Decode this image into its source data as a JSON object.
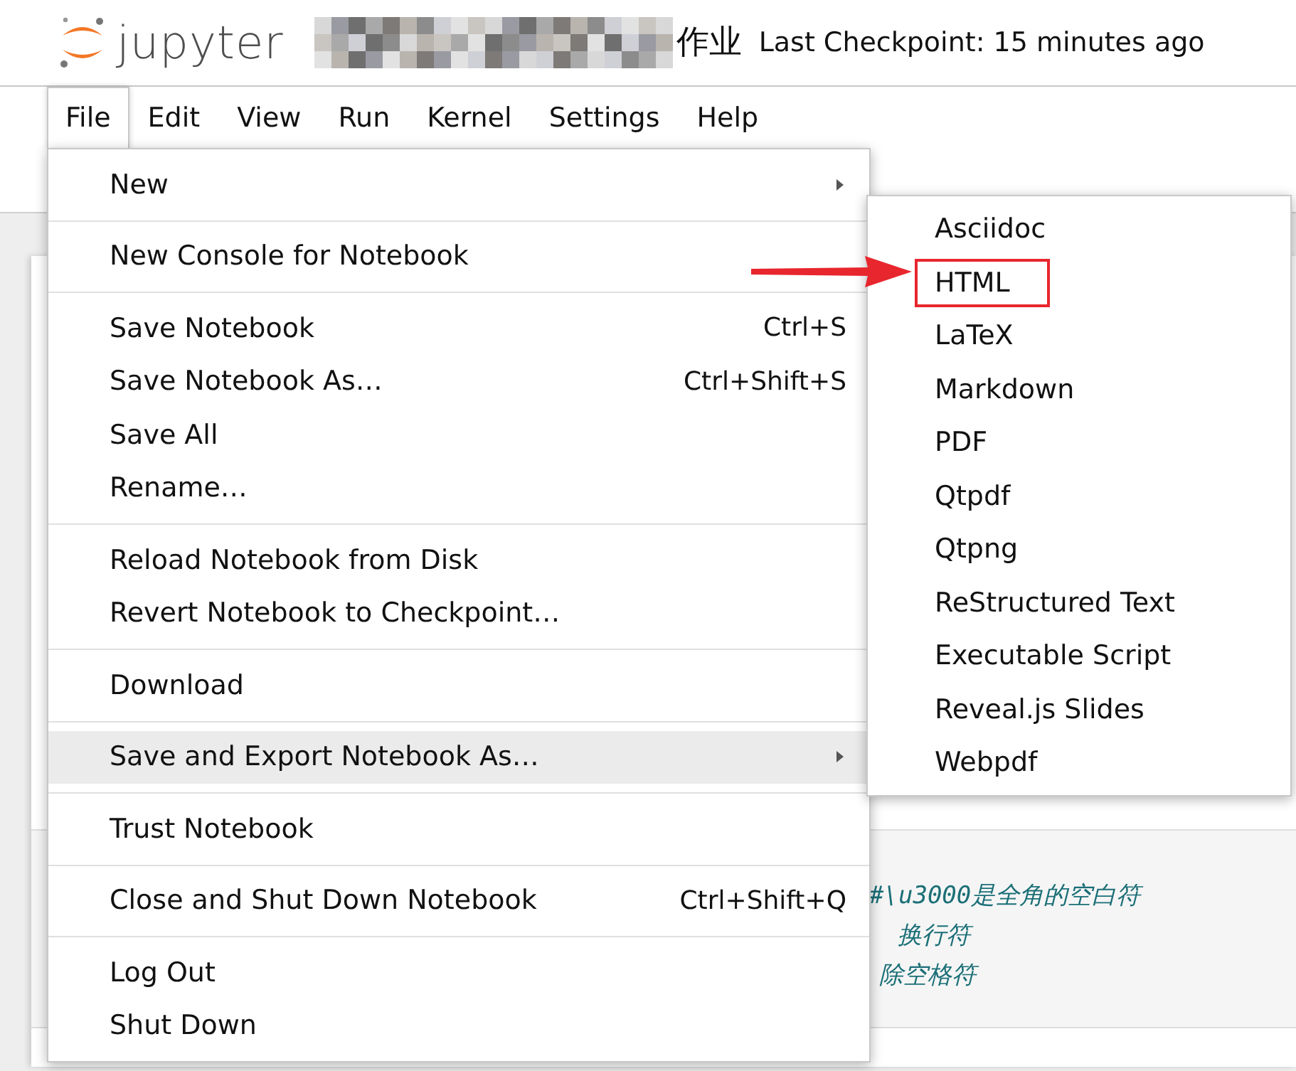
{
  "header": {
    "logo_text": "jupyter",
    "title": {
      "redacted": true,
      "text": "作业"
    },
    "checkpoint": "Last Checkpoint: 15 minutes ago"
  },
  "menubar": [
    {
      "label": "File",
      "selected": true
    },
    {
      "label": "Edit",
      "selected": false
    },
    {
      "label": "View",
      "selected": false
    },
    {
      "label": "Run",
      "selected": false
    },
    {
      "label": "Kernel",
      "selected": false
    },
    {
      "label": "Settings",
      "selected": false
    },
    {
      "label": "Help",
      "selected": false
    }
  ],
  "file_menu": [
    [
      {
        "label": "New",
        "submenu": true,
        "hovered": false
      }
    ],
    [
      {
        "label": "New Console for Notebook",
        "submenu": false,
        "hovered": false
      }
    ],
    [
      {
        "label": "Save Notebook",
        "shortcut": "Ctrl+S",
        "submenu": false,
        "hovered": false
      },
      {
        "label": "Save Notebook As…",
        "shortcut": "Ctrl+Shift+S",
        "submenu": false,
        "hovered": false
      },
      {
        "label": "Save All",
        "submenu": false,
        "hovered": false
      },
      {
        "label": "Rename…",
        "submenu": false,
        "hovered": false
      }
    ],
    [
      {
        "label": "Reload Notebook from Disk",
        "submenu": false,
        "hovered": false
      },
      {
        "label": "Revert Notebook to Checkpoint…",
        "submenu": false,
        "hovered": false
      }
    ],
    [
      {
        "label": "Download",
        "submenu": false,
        "hovered": false
      }
    ],
    [
      {
        "label": "Save and Export Notebook As…",
        "submenu": true,
        "hovered": true
      }
    ],
    [
      {
        "label": "Trust Notebook",
        "submenu": false,
        "hovered": false
      }
    ],
    [
      {
        "label": "Close and Shut Down Notebook",
        "shortcut": "Ctrl+Shift+Q",
        "submenu": false,
        "hovered": false
      }
    ],
    [
      {
        "label": "Log Out",
        "submenu": false,
        "hovered": false
      },
      {
        "label": "Shut Down",
        "submenu": false,
        "hovered": false
      }
    ]
  ],
  "export_submenu": [
    {
      "label": "Asciidoc",
      "annotated": false
    },
    {
      "label": "HTML",
      "annotated": true
    },
    {
      "label": "LaTeX",
      "annotated": false
    },
    {
      "label": "Markdown",
      "annotated": false
    },
    {
      "label": "PDF",
      "annotated": false
    },
    {
      "label": "Qtpdf",
      "annotated": false
    },
    {
      "label": "Qtpng",
      "annotated": false
    },
    {
      "label": "ReStructured Text",
      "annotated": false
    },
    {
      "label": "Executable Script",
      "annotated": false
    },
    {
      "label": "Reveal.js Slides",
      "annotated": false
    },
    {
      "label": "Webpdf",
      "annotated": false
    }
  ],
  "code_cell": {
    "lines": [
      "#\\u3000是全角的空白符",
      "换行符",
      "除空格符"
    ]
  }
}
